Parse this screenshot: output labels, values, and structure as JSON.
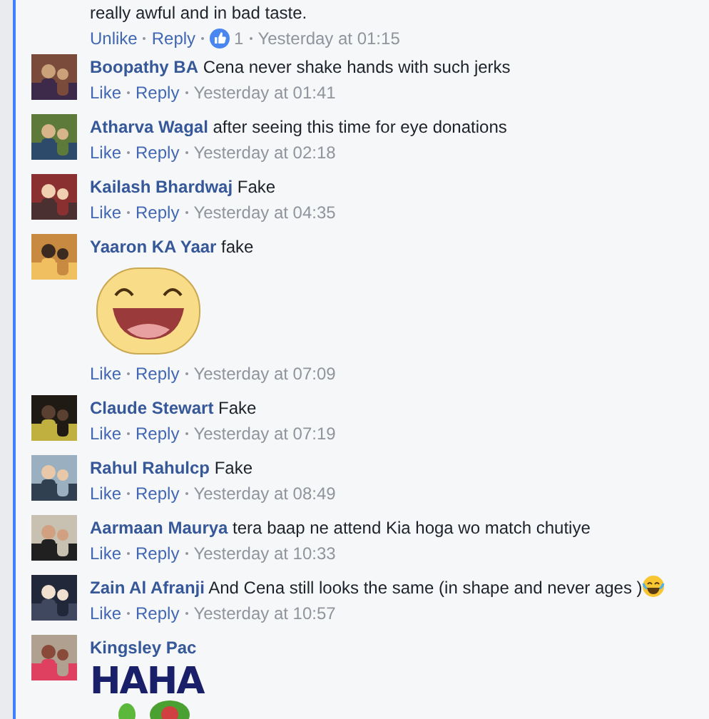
{
  "previous_comment": {
    "text_tail": "really awful and in bad taste.",
    "actions": {
      "like": "Unlike",
      "reply": "Reply",
      "like_count": "1",
      "time": "Yesterday at 01:15"
    }
  },
  "comments": [
    {
      "author": "Boopathy BA",
      "text": "Cena never shake hands with such jerks",
      "like": "Like",
      "reply": "Reply",
      "time": "Yesterday at 01:41"
    },
    {
      "author": "Atharva Wagal",
      "text": "after seeing this time for eye donations",
      "like": "Like",
      "reply": "Reply",
      "time": "Yesterday at 02:18"
    },
    {
      "author": "Kailash Bhardwaj",
      "text": "Fake",
      "like": "Like",
      "reply": "Reply",
      "time": "Yesterday at 04:35"
    },
    {
      "author": "Yaaron KA Yaar",
      "text": "fake",
      "attachment": {
        "kind": "smiley_sticker"
      },
      "like": "Like",
      "reply": "Reply",
      "time": "Yesterday at 07:09"
    },
    {
      "author": "Claude Stewart",
      "text": "Fake",
      "like": "Like",
      "reply": "Reply",
      "time": "Yesterday at 07:19"
    },
    {
      "author": "Rahul Rahulcp",
      "text": "Fake",
      "like": "Like",
      "reply": "Reply",
      "time": "Yesterday at 08:49"
    },
    {
      "author": "Aarmaan Maurya",
      "text": "tera baap ne attend Kia hoga wo match chutiye",
      "like": "Like",
      "reply": "Reply",
      "time": "Yesterday at 10:33"
    },
    {
      "author": "Zain Al Afranji",
      "text": "And Cena still looks the same (in shape and never ages )",
      "trailing_emoji": true,
      "like": "Like",
      "reply": "Reply",
      "time": "Yesterday at 10:57"
    },
    {
      "author": "Kingsley Pac",
      "attachment": {
        "kind": "text_sticker",
        "text": "HAHA"
      }
    }
  ]
}
